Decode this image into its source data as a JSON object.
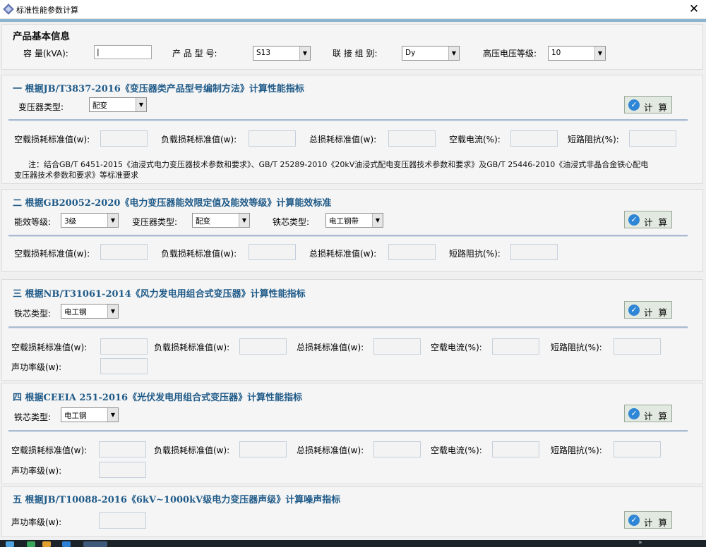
{
  "window": {
    "title": "标准性能参数计算",
    "close": "✕"
  },
  "basic": {
    "title": "产品基本信息",
    "capacity_label": "容 量(kVA):",
    "capacity_value": "|",
    "model_label": "产 品 型 号:",
    "model_value": "S13",
    "group_label": "联 接 组 别:",
    "group_value": "Dy",
    "voltage_label": "高压电压等级:",
    "voltage_value": "10"
  },
  "calc_label": "计 算",
  "s1": {
    "title": "一 根据JB/T3837-2016《变压器类产品型号编制方法》计算性能指标",
    "type_label": "变压器类型:",
    "type_value": "配变",
    "f1": "空载损耗标准值(w):",
    "f2": "负载损耗标准值(w):",
    "f3": "总损耗标准值(w):",
    "f4": "空载电流(%):",
    "f5": "短路阻抗(%):",
    "note_line1": "注：结合GB/T 6451-2015《油浸式电力变压器技术参数和要求》、GB/T 25289-2010《20kV油浸式配电变压器技术参数和要求》及GB/T 25446-2010《油浸式非晶合金铁心配电",
    "note_line2": "变压器技术参数和要求》等标准要求"
  },
  "s2": {
    "title": "二 根据GB20052-2020《电力变压器能效限定值及能效等级》计算能效标准",
    "eff_label": "能效等级:",
    "eff_value": "3级",
    "type_label": "变压器类型:",
    "type_value": "配变",
    "core_label": "铁芯类型:",
    "core_value": "电工钢带",
    "f1": "空载损耗标准值(w):",
    "f2": "负载损耗标准值(w):",
    "f3": "总损耗标准值(w):",
    "f4": "短路阻抗(%):"
  },
  "s3": {
    "title": "三 根据NB/T31061-2014《风力发电用组合式变压器》计算性能指标",
    "core_label": "铁芯类型:",
    "core_value": "电工钢",
    "f1": "空载损耗标准值(w):",
    "f2": "负载损耗标准值(w):",
    "f3": "总损耗标准值(w):",
    "f4": "空载电流(%):",
    "f5": "短路阻抗(%):",
    "f6": "声功率级(w):"
  },
  "s4": {
    "title": "四 根据CEEIA 251-2016《光伏发电用组合式变压器》计算性能指标",
    "core_label": "铁芯类型:",
    "core_value": "电工钢",
    "f1": "空载损耗标准值(w):",
    "f2": "负载损耗标准值(w):",
    "f3": "总损耗标准值(w):",
    "f4": "空载电流(%):",
    "f5": "短路阻抗(%):",
    "f6": "声功率级(w):"
  },
  "s5": {
    "title": "五 根据JB/T10088-2016《6kV~1000kV级电力变压器声级》计算噪声指标",
    "f1": "声功率级(w):"
  },
  "taskbar": {
    "chevron": "»"
  },
  "colors": {
    "accent": "#8db4cf",
    "section_title": "#1f5a88",
    "button_icon": "#2f86d6"
  }
}
